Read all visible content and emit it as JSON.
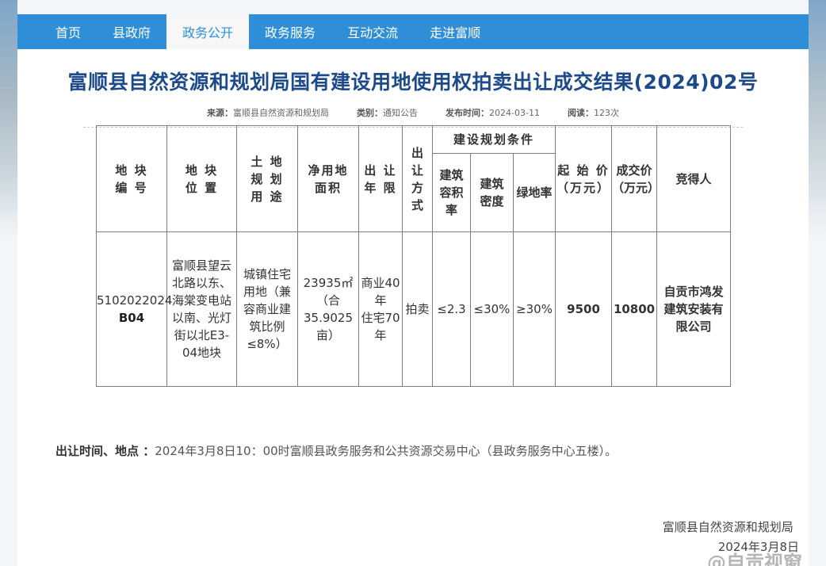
{
  "nav": {
    "items": [
      "首页",
      "县政府",
      "政务公开",
      "政务服务",
      "互动交流",
      "走进富顺"
    ]
  },
  "article": {
    "title": "富顺县自然资源和规划局国有建设用地使用权拍卖出让成交结果(2024)02号",
    "meta": {
      "source_label": "来源：",
      "source": "富顺县自然资源和规划局",
      "category_label": "类别：",
      "category": "通知公告",
      "date_label": "发布时间：",
      "date": "2024-03-11",
      "reads_label": "阅读：",
      "reads": "123次"
    }
  },
  "table": {
    "headers": {
      "parcel_no": [
        "地 块",
        "编 号"
      ],
      "location": [
        "地 块",
        "位 置"
      ],
      "usage": [
        "土 地",
        "规 划",
        "用 途"
      ],
      "area": [
        "净用地",
        "面积"
      ],
      "term": [
        "出 让",
        "年 限"
      ],
      "method": [
        "出",
        "让",
        "方",
        "式"
      ],
      "conditions": "建设规划条件",
      "far": [
        "建筑",
        "容积",
        "率"
      ],
      "density": [
        "建筑",
        "密度"
      ],
      "green": "绿地率",
      "start_price": [
        "起 始 价",
        "（万元）"
      ],
      "deal_price": [
        "成交价",
        "（万元）"
      ],
      "winner": "竞得人"
    },
    "row": {
      "parcel_no": [
        "5102022024",
        "B04"
      ],
      "location": [
        "富顺县望云",
        "北路以东、",
        "海棠变电站",
        "以南、光灯",
        "街以北E3-",
        "04地块"
      ],
      "usage": [
        "城镇住宅",
        "用地（兼",
        "容商业建",
        "筑比例",
        "≤8%）"
      ],
      "area": [
        "23935㎡",
        "（合",
        "35.9025",
        "亩）"
      ],
      "term": [
        "商业40",
        "年",
        "住宅70",
        "年"
      ],
      "method": "拍卖",
      "far": "≤2.3",
      "density": "≤30%",
      "green": "≥30%",
      "start_price": "9500",
      "deal_price": "10800",
      "winner": [
        "自贡市鸿发",
        "建筑安装有",
        "限公司"
      ]
    }
  },
  "notice": {
    "label": "出让时间、地点 ：",
    "text": "2024年3月8日10：00时富顺县政务服务和公共资源交易中心（县政务服务中心五楼）。"
  },
  "signature": {
    "org": "富顺县自然资源和规划局",
    "date": "2024年3月8日"
  },
  "watermark": "@自贡视窗"
}
